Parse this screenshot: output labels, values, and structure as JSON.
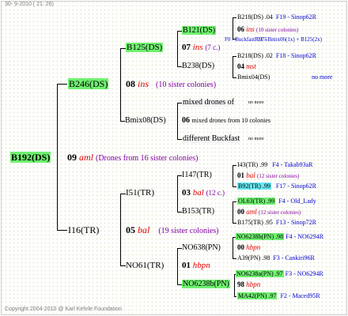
{
  "header": "30-  9-2010 ( 21: 26)",
  "footer": "Copyright 2004-2010 @ Karl Kehrle Foundation",
  "root": {
    "id": "B192(DS)",
    "year": "09",
    "queen": "aml",
    "note": "(Drones from 16 sister colonies)"
  },
  "gen1": {
    "mother": {
      "id": "B246(DS)",
      "year": "08",
      "queen": "ins",
      "note": "(10 sister colonies)"
    },
    "father": {
      "id": "I16(TR)",
      "year": "05",
      "queen": "bal",
      "note": "(19 sister colonies)"
    }
  },
  "gen2": {
    "b125": {
      "id": "B125(DS)",
      "year": "07",
      "queen": "ins",
      "note": "(7 c.)"
    },
    "bmix08": {
      "id": "Bmix08(DS)",
      "year": "06",
      "note": "mixed drones from 10 colonies"
    },
    "i51": {
      "id": "I51(TR)",
      "year": "03",
      "queen": "bal",
      "note": "(12 c.)"
    },
    "no61": {
      "id": "NO61(TR)",
      "year": "01",
      "queen": "hbpn"
    }
  },
  "gen3": {
    "b121": "B121(DS)",
    "b238": "B238(DS)",
    "mixed_drones": "mixed drones of",
    "different": "different Buckfast",
    "i147": "I147(TR)",
    "b153": "B153(TR)",
    "no638": "NO638(PN)",
    "no6238b": "NO6238b(PN)"
  },
  "gen4": {
    "r1": {
      "id": "B218(DS)",
      "year": ".04",
      "ref": "F19 - Sinop62R"
    },
    "r2": {
      "year": "06",
      "queen": "ins",
      "note": "(10 sister colonies)"
    },
    "r3": {
      "text1": "F0 - Buckfast 1975",
      "text2": "F11 - Bmix06(1x) + B125(2x)"
    },
    "r4": {
      "id": "B218(DS)",
      "year": ".02",
      "ref": "F18 - Sinop62R"
    },
    "r5": {
      "year": "04",
      "queen": "mst"
    },
    "r6": {
      "id": "Bmix04(DS)",
      "note": "no more"
    },
    "r7": {
      "note": "no more"
    },
    "r8": {
      "note": "no more"
    },
    "r9": {
      "id": "I43(TR)",
      "year": ".99",
      "ref": "F4 - Takab93aR"
    },
    "r10": {
      "year": "01",
      "queen": "bal",
      "note": "(12 sister colonies)"
    },
    "r11": {
      "id": "B92(TR)",
      "year": ".99",
      "ref": "F17 - Sinop62R"
    },
    "r12": {
      "id": "OL63(TR)",
      "year": ".99",
      "ref": "F4 - Old_Lady"
    },
    "r13": {
      "year": "00",
      "queen": "aml",
      "note": "(12 sister colonies)"
    },
    "r14": {
      "id": "B175(TR)",
      "year": ".95",
      "ref": "F13 - Sinop72R"
    },
    "r15": {
      "id": "NO6238b(PN)",
      "year": ".98",
      "ref": "F4 - NO6294R"
    },
    "r16": {
      "year": "00",
      "queen": "hbpn"
    },
    "r17": {
      "id": "A39(PN)",
      "year": ".98",
      "ref": "F3 - Cankiri96R"
    },
    "r18": {
      "id": "NO6238a(PN)",
      "year": ".97",
      "ref": "F3 - NO6294R"
    },
    "r19": {
      "year": "98",
      "queen": "hbpn"
    },
    "r20": {
      "id": "MA42(PN)",
      "year": ".97",
      "ref": "F2 - Maced95R"
    }
  }
}
